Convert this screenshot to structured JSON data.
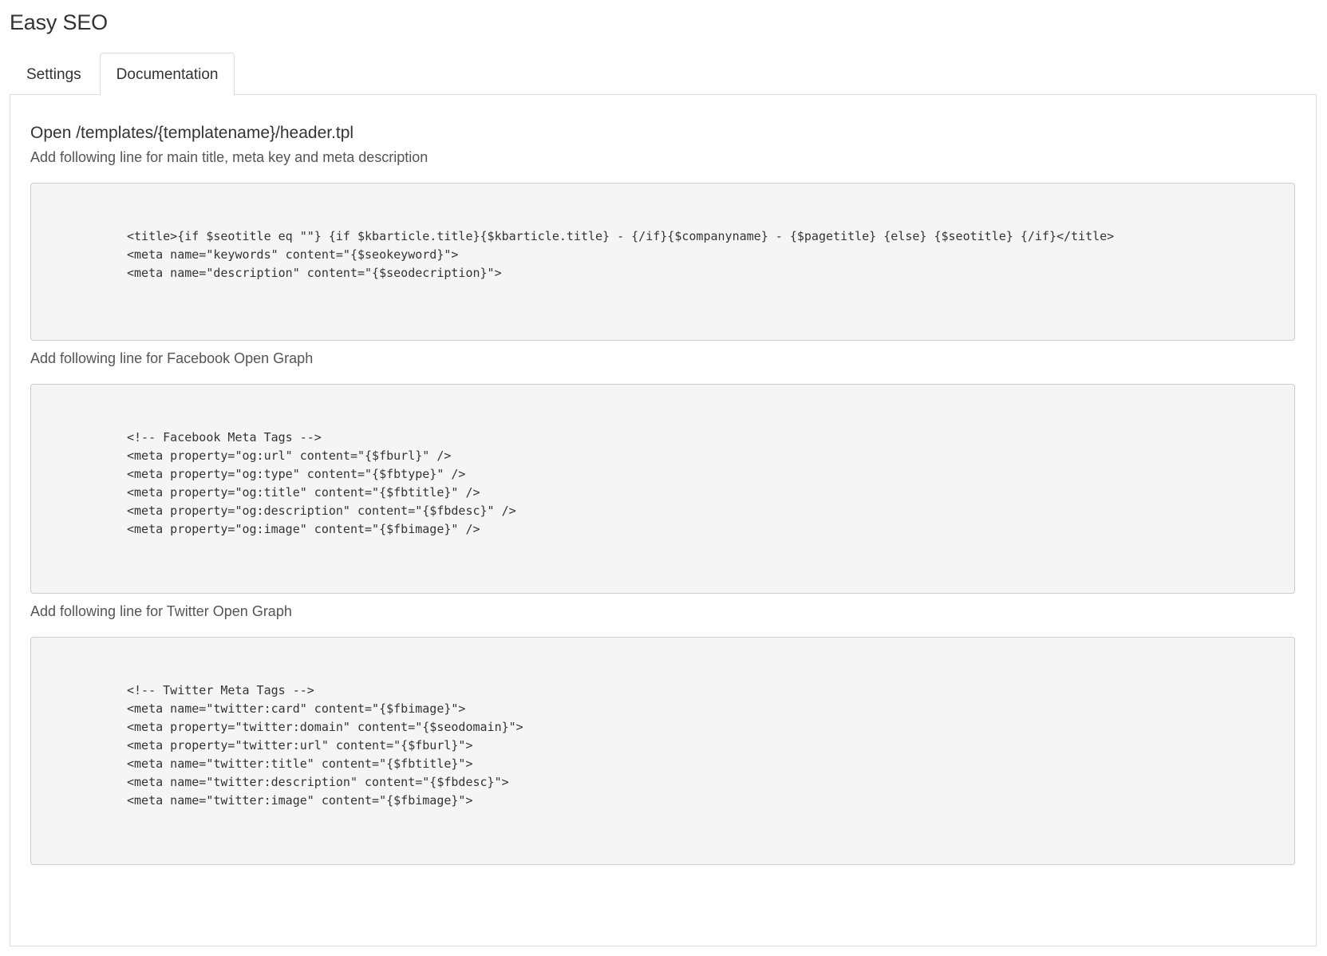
{
  "app": {
    "title": "Easy SEO"
  },
  "tabs": [
    {
      "label": "Settings",
      "active": false
    },
    {
      "label": "Documentation",
      "active": true
    }
  ],
  "documentation": {
    "heading": "Open /templates/{templatename}/header.tpl",
    "sections": [
      {
        "description": "Add following line for main title, meta key and meta description",
        "code": [
          "<title>{if $seotitle eq \"\"} {if $kbarticle.title}{$kbarticle.title} - {/if}{$companyname} - {$pagetitle} {else} {$seotitle} {/if}</title>",
          "<meta name=\"keywords\" content=\"{$seokeyword}\">",
          "<meta name=\"description\" content=\"{$seodecription}\">"
        ]
      },
      {
        "description": "Add following line for Facebook Open Graph",
        "code": [
          "<!-- Facebook Meta Tags -->",
          "<meta property=\"og:url\" content=\"{$fburl}\" />",
          "<meta property=\"og:type\" content=\"{$fbtype}\" />",
          "<meta property=\"og:title\" content=\"{$fbtitle}\" />",
          "<meta property=\"og:description\" content=\"{$fbdesc}\" />",
          "<meta property=\"og:image\" content=\"{$fbimage}\" />"
        ]
      },
      {
        "description": "Add following line for Twitter Open Graph",
        "code": [
          "<!-- Twitter Meta Tags -->",
          "<meta name=\"twitter:card\" content=\"{$fbimage}\">",
          "<meta property=\"twitter:domain\" content=\"{$seodomain}\">",
          "<meta property=\"twitter:url\" content=\"{$fburl}\">",
          "<meta name=\"twitter:title\" content=\"{$fbtitle}\">",
          "<meta name=\"twitter:description\" content=\"{$fbdesc}\">",
          "<meta name=\"twitter:image\" content=\"{$fbimage}\">"
        ]
      }
    ]
  }
}
